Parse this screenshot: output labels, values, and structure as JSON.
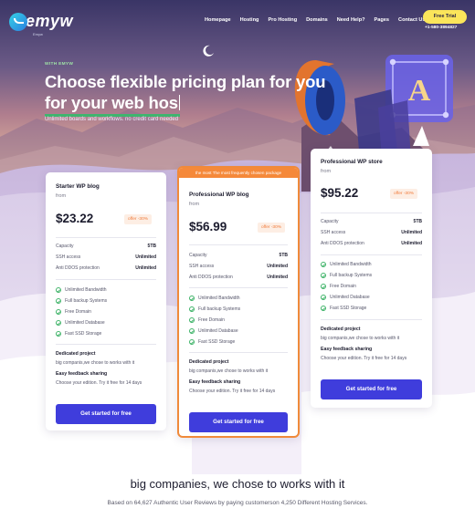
{
  "brand": {
    "name": "emyw",
    "tagline": "Emyw"
  },
  "nav": {
    "items": [
      "Homepage",
      "Hosting",
      "Pro Hosting",
      "Domains",
      "Need Help?",
      "Pages",
      "Contact Us"
    ]
  },
  "cta": {
    "trial": "Free Trial",
    "phone": "+1-580-3894827"
  },
  "hero": {
    "eyebrow": "WITH EMYW",
    "title_line1": "Choose flexible pricing plan for you",
    "title_line2": "for your web hos",
    "subtitle": "Unlimited boards and workflows. no credit card needed",
    "badge_letter": "A"
  },
  "plans": [
    {
      "name": "Starter WP blog",
      "from": "from",
      "price": "$23.22",
      "offer": "offer -30%",
      "specs": [
        {
          "label": "Capacity",
          "value": "5TB"
        },
        {
          "label": "SSH access",
          "value": "Unlimited"
        },
        {
          "label": "Anti DDOS protection",
          "value": "Unlimited"
        }
      ],
      "features": [
        "Unlimited Bandwidth",
        "Full backup Systems",
        "Free Domain",
        "Unlimited Database",
        "Fast SSD Storage"
      ],
      "dedicated_title": "Dedicated project",
      "dedicated_text": "big companis,we chose to works with it",
      "feedback_title": "Easy feedback sharing",
      "feedback_text": "Choose your edition. Try it free for 14 days",
      "button": "Get started for free"
    },
    {
      "ribbon": "the most The most frequently chosen package",
      "name": "Professional WP blog",
      "from": "from",
      "price": "$56.99",
      "offer": "offer -30%",
      "specs": [
        {
          "label": "Capacity",
          "value": "5TB"
        },
        {
          "label": "SSH access",
          "value": "Unlimited"
        },
        {
          "label": "Anti DDOS protection",
          "value": "Unlimited"
        }
      ],
      "features": [
        "Unlimited Bandwidth",
        "Full backup Systems",
        "Free Domain",
        "Unlimited Database",
        "Fast SSD Storage"
      ],
      "dedicated_title": "Dedicated project",
      "dedicated_text": "big companis,we chose to works with it",
      "feedback_title": "Easy feedback sharing",
      "feedback_text": "Choose your edition. Try it free for 14 days",
      "button": "Get started for free"
    },
    {
      "name": "Professional WP store",
      "from": "from",
      "price": "$95.22",
      "offer": "offer -30%",
      "specs": [
        {
          "label": "Capacity",
          "value": "5TB"
        },
        {
          "label": "SSH access",
          "value": "Unlimited"
        },
        {
          "label": "Anti DDOS protection",
          "value": "Unlimited"
        }
      ],
      "features": [
        "Unlimited Bandwidth",
        "Full backup Systems",
        "Free Domain",
        "Unlimited Database",
        "Fast SSD Storage"
      ],
      "dedicated_title": "Dedicated project",
      "dedicated_text": "big companis,we chose to works with it",
      "feedback_title": "Easy feedback sharing",
      "feedback_text": "Choose your edition. Try it free for 14 days",
      "button": "Get started for free"
    }
  ],
  "clients": {
    "title": "big companies, we chose to works with it",
    "subtitle": "Based on 64,627 Authentic User Reviews by paying customerson 4,250 Different Hosting Services."
  },
  "colors": {
    "accent": "#3f3ddc",
    "offer": "#f07a3a",
    "highlight": "#f5893a",
    "check": "#41b46a",
    "trial": "#fbe55a"
  }
}
